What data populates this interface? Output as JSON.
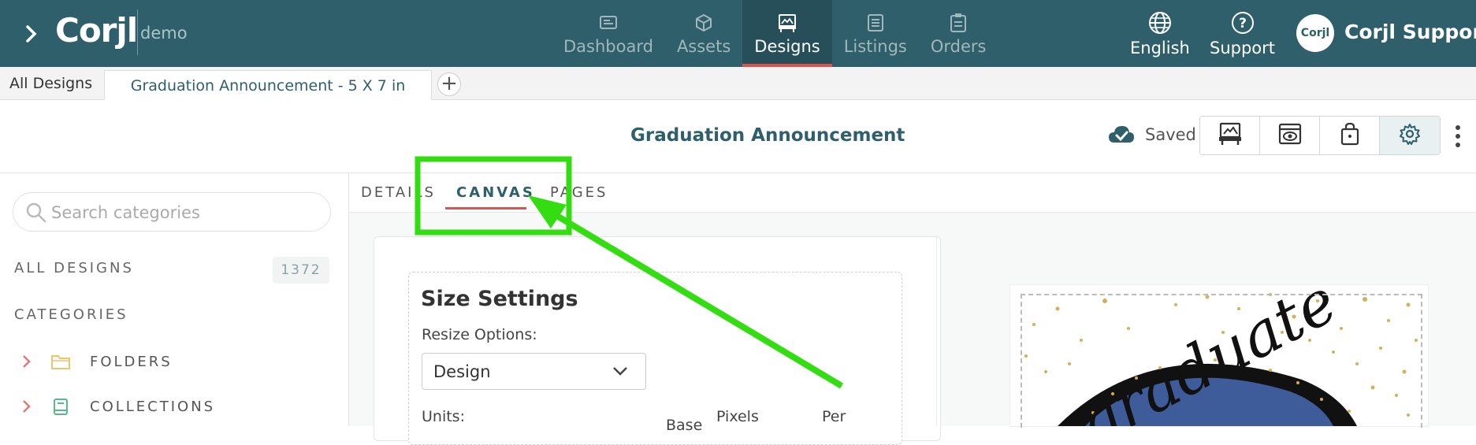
{
  "colors": {
    "brand": "#2e5f6b",
    "accent": "#d9534f",
    "annotation": "#33dd11"
  },
  "topbar": {
    "menu_icon": "chevron-right-icon",
    "logo": "Corjl",
    "logo_sub": "demo",
    "nav": [
      {
        "label": "Dashboard",
        "icon": "dashboard-icon",
        "active": false
      },
      {
        "label": "Assets",
        "icon": "cube-icon",
        "active": false
      },
      {
        "label": "Designs",
        "icon": "designs-icon",
        "active": true
      },
      {
        "label": "Listings",
        "icon": "listings-icon",
        "active": false
      },
      {
        "label": "Orders",
        "icon": "clipboard-icon",
        "active": false
      }
    ],
    "language": "English",
    "support": "Support",
    "avatar_text": "Corjl",
    "user": "Corjl Support"
  },
  "tabs": {
    "all_designs": "All Designs",
    "current": "Graduation Announcement - 5 X 7 in",
    "add": "+"
  },
  "header": {
    "title": "Graduation Announcement",
    "saved": "Saved"
  },
  "sidebar": {
    "search_placeholder": "Search categories",
    "all_designs": "ALL DESIGNS",
    "count": "1372",
    "categories": "CATEGORIES",
    "items": [
      {
        "label": "FOLDERS",
        "icon": "folder-icon"
      },
      {
        "label": "COLLECTIONS",
        "icon": "book-icon"
      }
    ]
  },
  "content_tabs": [
    {
      "label": "DETAILS",
      "active": false
    },
    {
      "label": "CANVAS",
      "active": true
    },
    {
      "label": "PAGES",
      "active": false
    }
  ],
  "size_settings": {
    "title": "Size Settings",
    "resize_label": "Resize Options:",
    "resize_value": "Design",
    "units_label": "Units:",
    "col_base": "Base",
    "col_pixels": "Pixels",
    "col_per": "Per"
  },
  "preview": {
    "script_text": "graduate"
  }
}
